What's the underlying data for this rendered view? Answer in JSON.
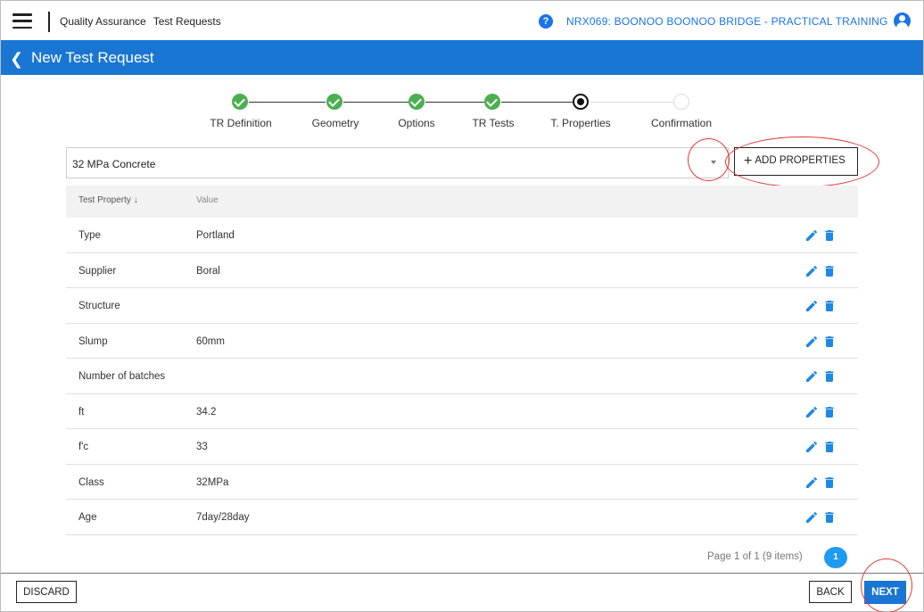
{
  "topbar": {
    "breadcrumb": [
      "Quality Assurance",
      "Test Requests"
    ],
    "help_glyph": "?",
    "project": "NRX069: BOONOO BOONOO BRIDGE - PRACTICAL TRAINING"
  },
  "header": {
    "title": "New Test Request"
  },
  "stepper": {
    "steps": [
      {
        "label": "TR Definition",
        "status": "done"
      },
      {
        "label": "Geometry",
        "status": "done"
      },
      {
        "label": "Options",
        "status": "done"
      },
      {
        "label": "TR Tests",
        "status": "done"
      },
      {
        "label": "T. Properties",
        "status": "current"
      },
      {
        "label": "Confirmation",
        "status": "future"
      }
    ]
  },
  "selector": {
    "value": "32 MPa Concrete"
  },
  "add_properties_label": "ADD PROPERTIES",
  "table": {
    "columns": [
      "Test Property ↓",
      "Value"
    ],
    "rows": [
      {
        "property": "Type",
        "value": "Portland"
      },
      {
        "property": "Supplier",
        "value": "Boral"
      },
      {
        "property": "Structure",
        "value": ""
      },
      {
        "property": "Slump",
        "value": "60mm"
      },
      {
        "property": "Number of batches",
        "value": ""
      },
      {
        "property": "ft",
        "value": "34.2"
      },
      {
        "property": "f'c",
        "value": "33"
      },
      {
        "property": "Class",
        "value": "32MPa"
      },
      {
        "property": "Age",
        "value": "7day/28day"
      }
    ]
  },
  "pagination": {
    "summary": "Page 1 of 1 (9 items)",
    "current_page": "1"
  },
  "footer": {
    "discard_label": "DISCARD",
    "back_label": "BACK",
    "next_label": "NEXT"
  },
  "colors": {
    "brand_blue": "#1976d2",
    "step_done": "#4caf50",
    "action_blue": "#1e88e5",
    "annotation_red": "#e53935"
  },
  "icons": {
    "edit": "pencil-icon",
    "delete": "trash-icon"
  }
}
